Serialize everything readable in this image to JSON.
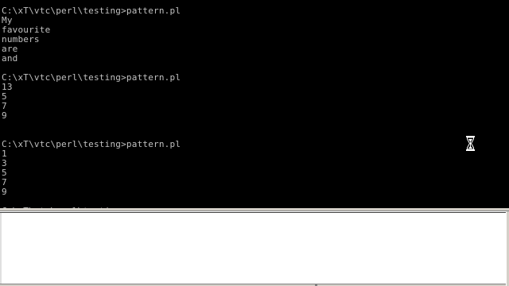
{
  "console": {
    "lines": [
      "C:\\xT\\vtc\\perl\\testing>pattern.pl",
      "My",
      "favourite",
      "numbers",
      "are",
      "and",
      "",
      "C:\\xT\\vtc\\perl\\testing>pattern.pl",
      "13",
      "5",
      "7",
      "9",
      "",
      "",
      "C:\\xT\\vtc\\perl\\testing>pattern.pl",
      "1",
      "3",
      "5",
      "7",
      "9",
      "",
      "C:\\xT\\vtc\\perl\\testing>"
    ],
    "colors": {
      "background": "#000000",
      "text": "#c0c0c0"
    }
  },
  "cursor": {
    "icon": "hourglass-busy-cursor-icon"
  },
  "lower_pane": {
    "colors": {
      "background": "#ffffff",
      "frame": "#d4d0c8"
    }
  }
}
